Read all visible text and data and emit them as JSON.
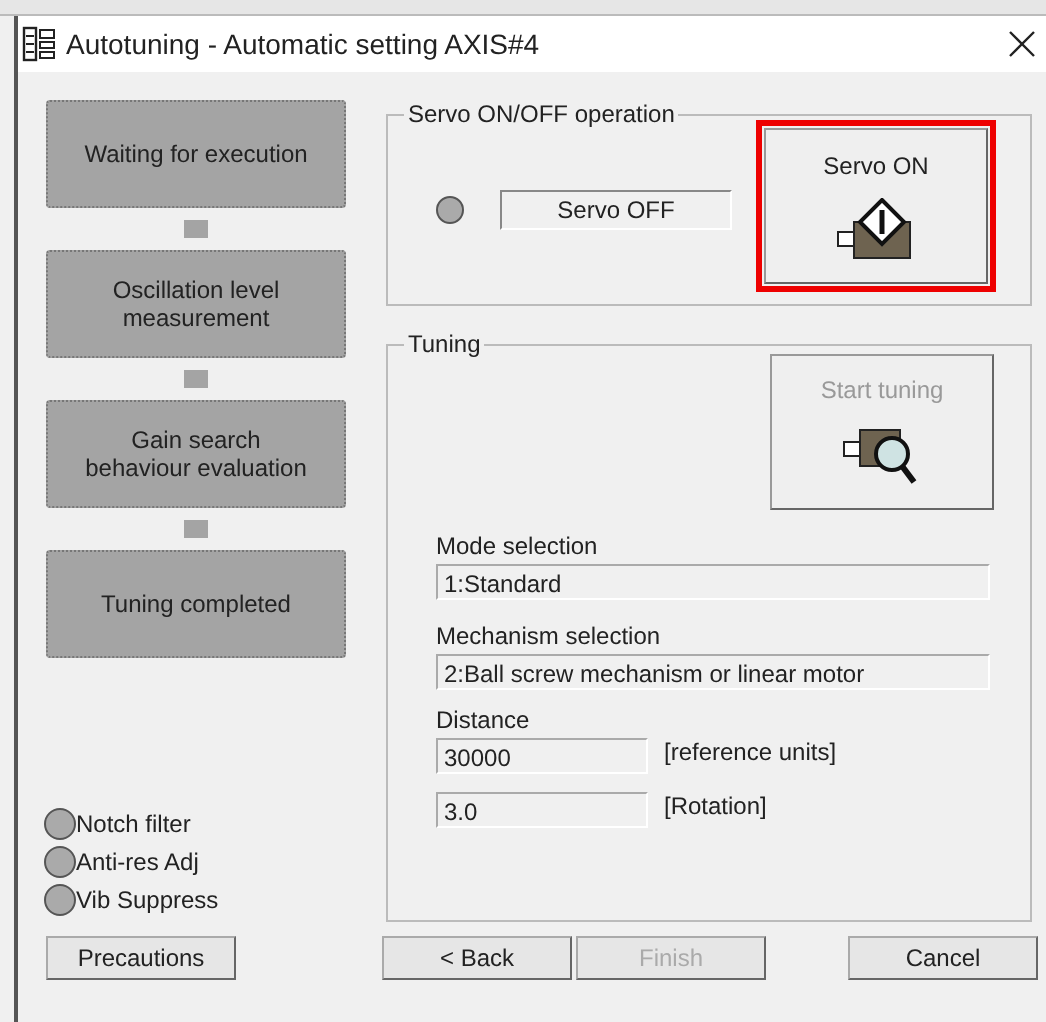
{
  "window": {
    "title": "Autotuning - Automatic setting AXIS#4"
  },
  "steps": [
    {
      "label": "Waiting for execution"
    },
    {
      "label": "Oscillation level measurement"
    },
    {
      "label": "Gain search behaviour evaluation"
    },
    {
      "label": "Tuning completed"
    }
  ],
  "indicators": [
    {
      "label": "Notch filter",
      "on": false
    },
    {
      "label": "Anti-res Adj",
      "on": false
    },
    {
      "label": "Vib Suppress",
      "on": false
    }
  ],
  "servo_group": {
    "title": "Servo ON/OFF operation",
    "lamp_on": false,
    "status": "Servo OFF",
    "button": {
      "label": "Servo ON",
      "highlighted": true,
      "disabled": false
    }
  },
  "tuning_group": {
    "title": "Tuning",
    "button": {
      "label": "Start tuning",
      "disabled": true
    },
    "fields": [
      {
        "label": "Mode selection",
        "value": "1:Standard"
      },
      {
        "label": "Mechanism selection",
        "value": "2:Ball screw mechanism or linear motor"
      }
    ],
    "distance": {
      "label": "Distance",
      "entries": [
        {
          "value": "30000",
          "unit": "[reference units]"
        },
        {
          "value": "3.0",
          "unit": "[Rotation]"
        }
      ]
    }
  },
  "buttons": [
    {
      "label": "Precautions",
      "disabled": false
    },
    {
      "label": "< Back",
      "disabled": false
    },
    {
      "label": "Finish",
      "disabled": true
    },
    {
      "label": "Cancel",
      "disabled": false
    }
  ]
}
